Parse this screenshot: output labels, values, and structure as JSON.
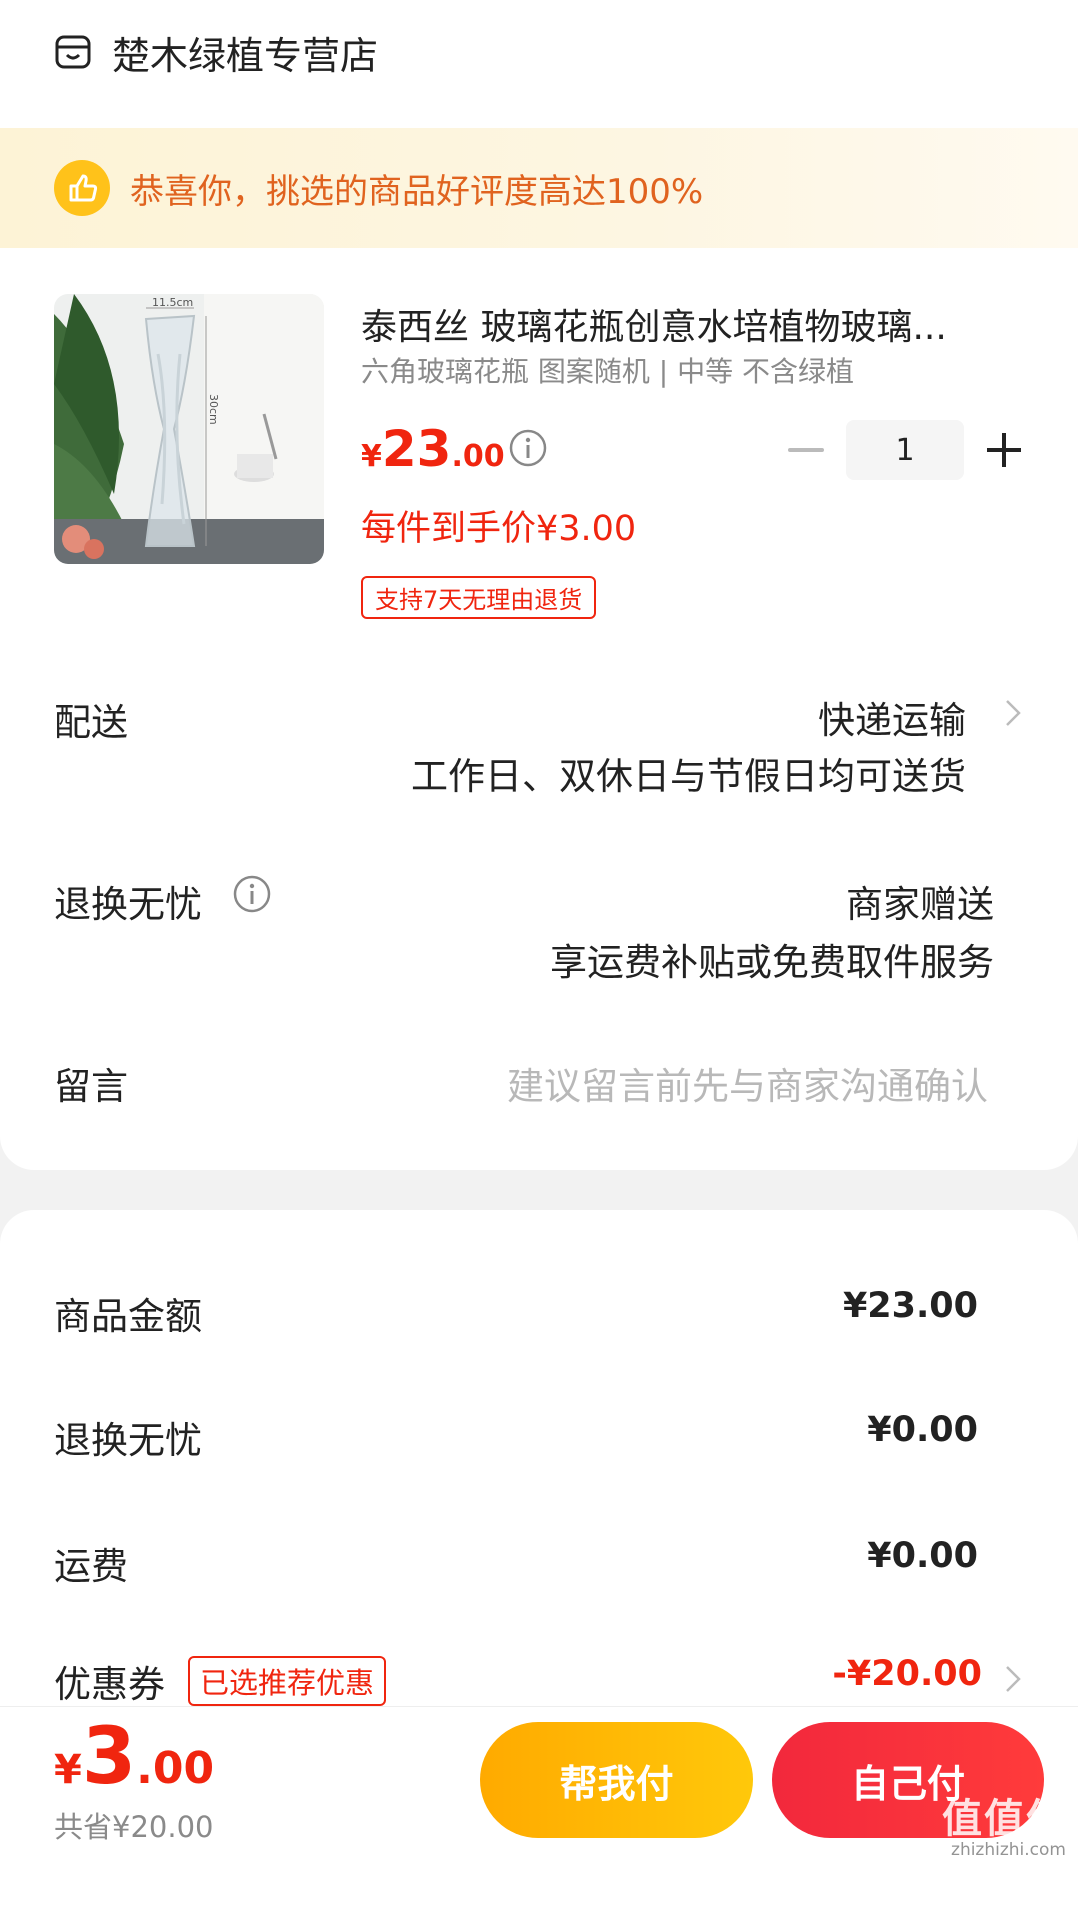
{
  "store": {
    "name": "楚木绿植专营店",
    "icon": "store-icon"
  },
  "banner": {
    "text": "恭喜你，挑选的商品好评度高达100%",
    "icon": "thumbs-up-icon"
  },
  "product": {
    "title": "泰西丝 玻璃花瓶创意水培植物玻璃...",
    "spec": "六角玻璃花瓶 图案随机 | 中等 不含绿植",
    "price_yen": "¥",
    "price_int": "23",
    "price_dec": ".00",
    "final_price": "每件到手价¥3.00",
    "tag": "支持7天无理由退货",
    "quantity": "1",
    "image_labels": {
      "width": "11.5cm",
      "height": "30cm"
    }
  },
  "delivery": {
    "label": "配送",
    "method": "快递运输",
    "note": "工作日、双休日与节假日均可送货"
  },
  "return_service": {
    "label": "退换无忧",
    "value": "商家赠送",
    "note": "享运费补贴或免费取件服务"
  },
  "message": {
    "label": "留言",
    "placeholder": "建议留言前先与商家沟通确认"
  },
  "summary": {
    "goods_label": "商品金额",
    "goods_value": "¥23.00",
    "return_label": "退换无忧",
    "return_value": "¥0.00",
    "shipping_label": "运费",
    "shipping_value": "¥0.00",
    "coupon_label": "优惠券",
    "coupon_tag": "已选推荐优惠",
    "coupon_value": "-¥20.00"
  },
  "footer": {
    "total_yen": "¥",
    "total_int": "3",
    "total_dec": ".00",
    "saved": "共省¥20.00",
    "help_pay": "帮我付",
    "self_pay": "自己付"
  },
  "watermark": {
    "text": "值值值",
    "url": "zhizhizhi.com"
  },
  "colors": {
    "accent_red": "#f0250f",
    "banner_orange": "#e0631f",
    "help_btn": "#ffb400"
  }
}
